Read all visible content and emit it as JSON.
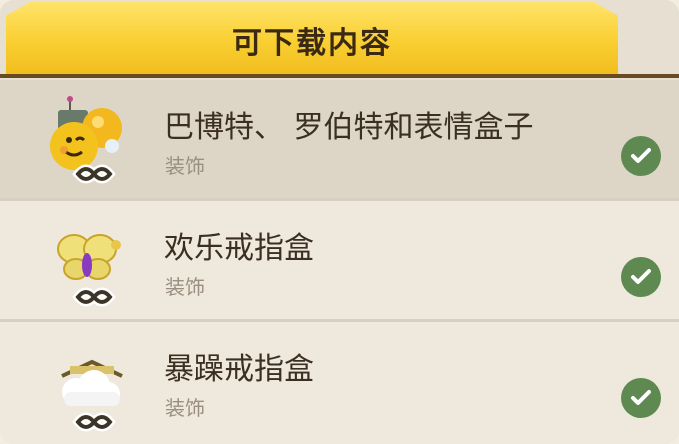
{
  "header": {
    "title": "可下载内容"
  },
  "items": [
    {
      "title": "巴博特、 罗伯特和表情盒子",
      "subtitle": "装饰",
      "icon": "emoji-robot-box-icon",
      "owned": true
    },
    {
      "title": "欢乐戒指盒",
      "subtitle": "装饰",
      "icon": "butterfly-ring-icon",
      "owned": true
    },
    {
      "title": "暴躁戒指盒",
      "subtitle": "装饰",
      "icon": "cloud-ring-icon",
      "owned": true
    }
  ],
  "colors": {
    "header_gold": "#f9cf32",
    "check_green": "#5e8a52",
    "text_dark": "#3b2f22",
    "text_muted": "#9a8f80"
  }
}
